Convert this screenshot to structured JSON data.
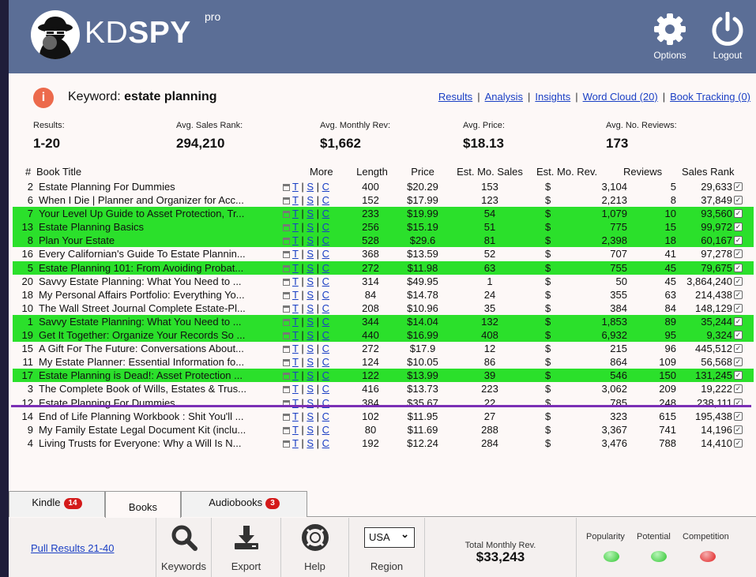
{
  "header": {
    "logo_main": "KD",
    "logo_bold": "SPY",
    "logo_sup": "pro",
    "options_label": "Options",
    "logout_label": "Logout"
  },
  "keyword": {
    "label": "Keyword:",
    "value": "estate planning",
    "info_icon_glyph": "i"
  },
  "nav": {
    "links": [
      "Results",
      "Analysis",
      "Insights",
      "Word Cloud (20)",
      "Book Tracking (0)"
    ],
    "separator": "|"
  },
  "stats": {
    "results_label": "Results:",
    "results_value": "1-20",
    "sales_rank_label": "Avg. Sales Rank:",
    "sales_rank_value": "294,210",
    "monthly_rev_label": "Avg. Monthly Rev:",
    "monthly_rev_value": "$1,662",
    "price_label": "Avg. Price:",
    "price_value": "$18.13",
    "reviews_label": "Avg. No. Reviews:",
    "reviews_value": "173"
  },
  "table": {
    "headers": {
      "num": "#",
      "title": "Book Title",
      "more": "More",
      "length": "Length",
      "price": "Price",
      "sales": "Est. Mo. Sales",
      "rev": "Est. Mo. Rev.",
      "reviews": "Reviews",
      "rank": "Sales Rank"
    },
    "more_links": [
      "T",
      "S",
      "C"
    ],
    "more_sep": "|",
    "dollar": "$",
    "checkbox_glyph": "✓",
    "highlight_color": "#2be02b",
    "rows": [
      {
        "num": "2",
        "title": "Estate Planning For Dummies",
        "length": "400",
        "price": "$20.29",
        "sales": "153",
        "rev": "3,104",
        "reviews": "5",
        "rank": "29,633",
        "hl": false
      },
      {
        "num": "6",
        "title": "When I Die | Planner and Organizer for Acc...",
        "length": "152",
        "price": "$17.99",
        "sales": "123",
        "rev": "2,213",
        "reviews": "8",
        "rank": "37,849",
        "hl": false
      },
      {
        "num": "7",
        "title": "Your Level Up Guide to Asset Protection, Tr...",
        "length": "233",
        "price": "$19.99",
        "sales": "54",
        "rev": "1,079",
        "reviews": "10",
        "rank": "93,560",
        "hl": true
      },
      {
        "num": "13",
        "title": "Estate Planning Basics",
        "length": "256",
        "price": "$15.19",
        "sales": "51",
        "rev": "775",
        "reviews": "15",
        "rank": "99,972",
        "hl": true
      },
      {
        "num": "8",
        "title": "Plan Your Estate",
        "length": "528",
        "price": "$29.6",
        "sales": "81",
        "rev": "2,398",
        "reviews": "18",
        "rank": "60,167",
        "hl": true
      },
      {
        "num": "16",
        "title": "Every Californian's Guide To Estate Plannin...",
        "length": "368",
        "price": "$13.59",
        "sales": "52",
        "rev": "707",
        "reviews": "41",
        "rank": "97,278",
        "hl": false
      },
      {
        "num": "5",
        "title": "Estate Planning 101: From Avoiding Probat...",
        "length": "272",
        "price": "$11.98",
        "sales": "63",
        "rev": "755",
        "reviews": "45",
        "rank": "79,675",
        "hl": true
      },
      {
        "num": "20",
        "title": "Savvy Estate Planning: What You Need to ...",
        "length": "314",
        "price": "$49.95",
        "sales": "1",
        "rev": "50",
        "reviews": "45",
        "rank": "3,864,240",
        "hl": false
      },
      {
        "num": "18",
        "title": "My Personal Affairs Portfolio: Everything Yo...",
        "length": "84",
        "price": "$14.78",
        "sales": "24",
        "rev": "355",
        "reviews": "63",
        "rank": "214,438",
        "hl": false
      },
      {
        "num": "10",
        "title": "The Wall Street Journal Complete Estate-Pl...",
        "length": "208",
        "price": "$10.96",
        "sales": "35",
        "rev": "384",
        "reviews": "84",
        "rank": "148,129",
        "hl": false
      },
      {
        "num": "1",
        "title": "Savvy Estate Planning: What You Need to ...",
        "length": "344",
        "price": "$14.04",
        "sales": "132",
        "rev": "1,853",
        "reviews": "89",
        "rank": "35,244",
        "hl": true
      },
      {
        "num": "19",
        "title": "Get It Together: Organize Your Records So ...",
        "length": "440",
        "price": "$16.99",
        "sales": "408",
        "rev": "6,932",
        "reviews": "95",
        "rank": "9,324",
        "hl": true
      },
      {
        "num": "15",
        "title": "A Gift For The Future: Conversations About...",
        "length": "272",
        "price": "$17.9",
        "sales": "12",
        "rev": "215",
        "reviews": "96",
        "rank": "445,512",
        "hl": false
      },
      {
        "num": "11",
        "title": "My Estate Planner: Essential Information fo...",
        "length": "124",
        "price": "$10.05",
        "sales": "86",
        "rev": "864",
        "reviews": "109",
        "rank": "56,568",
        "hl": false
      },
      {
        "num": "17",
        "title": "Estate Planning is Dead!: Asset Protection ...",
        "length": "122",
        "price": "$13.99",
        "sales": "39",
        "rev": "546",
        "reviews": "150",
        "rank": "131,245",
        "hl": true
      },
      {
        "num": "3",
        "title": "The Complete Book of Wills, Estates & Trus...",
        "length": "416",
        "price": "$13.73",
        "sales": "223",
        "rev": "3,062",
        "reviews": "209",
        "rank": "19,222",
        "hl": false
      },
      {
        "num": "12",
        "title": "Estate Planning For Dummies",
        "length": "384",
        "price": "$35.67",
        "sales": "22",
        "rev": "785",
        "reviews": "248",
        "rank": "238,111",
        "hl": false
      },
      {
        "num": "14",
        "title": "End of Life Planning Workbook : Shit You'll ...",
        "length": "102",
        "price": "$11.95",
        "sales": "27",
        "rev": "323",
        "reviews": "615",
        "rank": "195,438",
        "hl": false
      },
      {
        "num": "9",
        "title": "My Family Estate Legal Document Kit (inclu...",
        "length": "80",
        "price": "$11.69",
        "sales": "288",
        "rev": "3,367",
        "reviews": "741",
        "rank": "14,196",
        "hl": false
      },
      {
        "num": "4",
        "title": "Living Trusts for Everyone: Why a Will Is N...",
        "length": "192",
        "price": "$12.24",
        "sales": "284",
        "rev": "3,476",
        "reviews": "788",
        "rank": "14,410",
        "hl": false
      }
    ]
  },
  "tabs": [
    {
      "label": "Kindle",
      "badge": "14"
    },
    {
      "label": "Books",
      "badge": ""
    },
    {
      "label": "Audiobooks",
      "badge": "3"
    }
  ],
  "footer": {
    "pull_link": "Pull Results 21-40",
    "keywords_label": "Keywords",
    "export_label": "Export",
    "help_label": "Help",
    "region_value": "USA",
    "region_caret": "⌄",
    "region_label": "Region",
    "total_rev_label": "Total Monthly Rev.",
    "total_rev_value": "$33,243",
    "popularity_label": "Popularity",
    "potential_label": "Potential",
    "competition_label": "Competition",
    "popularity_color": "#2ec42e",
    "potential_color": "#2ec42e",
    "competition_color": "#e01c1c"
  }
}
